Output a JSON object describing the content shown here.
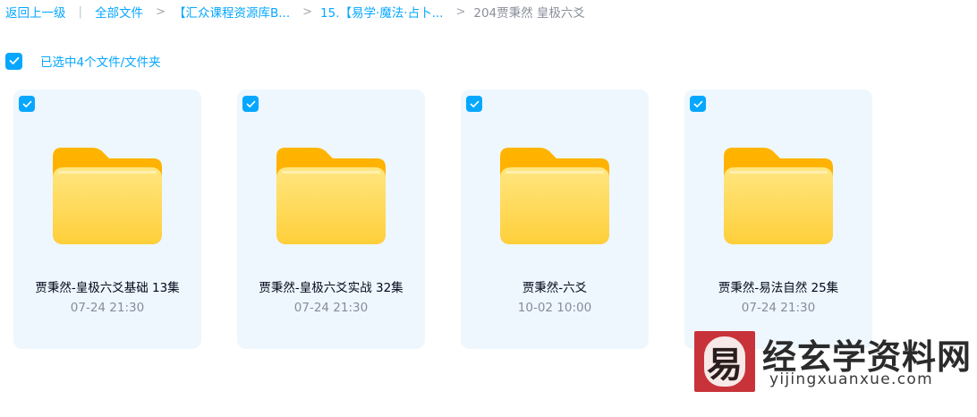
{
  "breadcrumb": {
    "back": "返回上一级",
    "items": [
      "全部文件",
      "【汇众课程资源库B...",
      "15.【易学·魔法·占卜...",
      "204贾秉然 皇极六爻"
    ]
  },
  "selection": {
    "text": "已选中4个文件/文件夹"
  },
  "files": [
    {
      "name": "贾秉然-皇极六爻基础 13集",
      "date": "07-24 21:30",
      "checked": true
    },
    {
      "name": "贾秉然-皇极六爻实战 32集",
      "date": "07-24 21:30",
      "checked": true
    },
    {
      "name": "贾秉然-六爻",
      "date": "10-02 10:00",
      "checked": true
    },
    {
      "name": "贾秉然-易法自然 25集",
      "date": "07-24 21:30",
      "checked": true
    }
  ],
  "watermark": {
    "logo_char": "易",
    "title": "经玄学资料网",
    "url": "yijingxuanxue.com"
  },
  "colors": {
    "accent": "#06a7ff",
    "card_bg": "#eef7fe",
    "folder_yellow": "#ffd54f",
    "watermark_red": "#c8333a"
  },
  "icons": [
    "check-icon",
    "folder-icon"
  ]
}
